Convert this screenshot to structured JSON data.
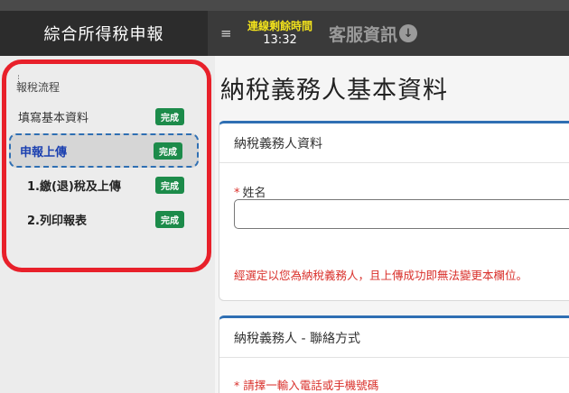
{
  "app": {
    "title": "綜合所得稅申報"
  },
  "topbar": {
    "menu_icon": "hamburger-icon",
    "timer_label": "連線剩餘時間",
    "timer_value": "13:32",
    "service_label": "客服資訊",
    "service_icon": "chevron-down-circle-icon"
  },
  "sidebar": {
    "highlight_color": "#e8202a",
    "section_title": "報稅流程",
    "items": [
      {
        "label": "填寫基本資料",
        "badge": "完成"
      },
      {
        "label": "申報上傳",
        "badge": "完成"
      },
      {
        "label": "1.繳(退)稅及上傳",
        "badge": "完成"
      },
      {
        "label": "2.列印報表",
        "badge": "完成"
      }
    ]
  },
  "main": {
    "page_title": "納稅義務人基本資料",
    "card1": {
      "header": "納稅義務人資料",
      "field_required_mark": "*",
      "field_label": "姓名",
      "field_value": "",
      "notice": "經選定以您為納稅義務人，且上傳成功即無法變更本欄位。"
    },
    "card2": {
      "header": "納稅義務人 - 聯絡方式",
      "hint": "* 請擇一輸入電話或手機號碼"
    }
  },
  "colors": {
    "badge": "#1c8b4a",
    "accent": "#2f6fb3",
    "warning": "#d9302b",
    "timer": "#f2e21c"
  }
}
